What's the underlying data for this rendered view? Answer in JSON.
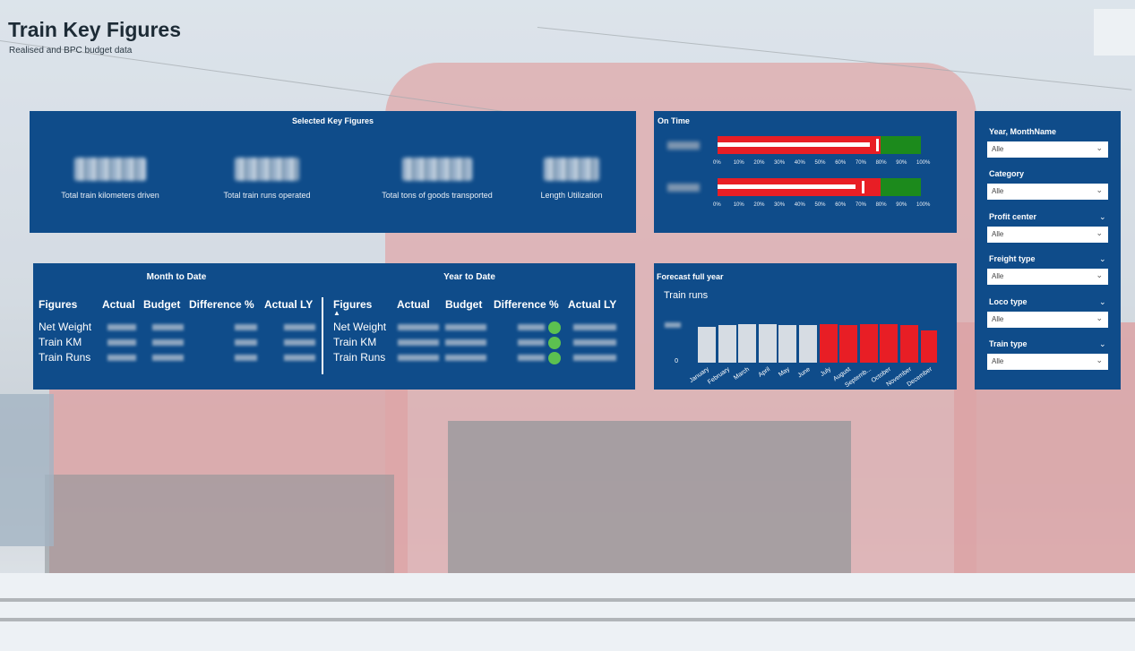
{
  "header": {
    "title": "Train Key Figures",
    "subtitle": "Realised and BPC budget data"
  },
  "selected_key_figures": {
    "title": "Selected Key Figures",
    "kpis": [
      {
        "label": "Total train kilometers driven"
      },
      {
        "label": "Total train runs operated"
      },
      {
        "label": "Total tons of goods transported"
      },
      {
        "label": "Length Utilization"
      }
    ]
  },
  "on_time": {
    "title": "On Time",
    "axis_ticks": [
      "0%",
      "10%",
      "20%",
      "30%",
      "40%",
      "50%",
      "60%",
      "70%",
      "80%",
      "90%",
      "100%"
    ],
    "bullets": [
      {
        "actual_pct": 75,
        "target_pct": 78,
        "good_from_pct": 80
      },
      {
        "actual_pct": 68,
        "target_pct": 71,
        "good_from_pct": 80
      }
    ],
    "colors": {
      "bad": "#e81e25",
      "good": "#1c8a1c",
      "marker": "#ffffff"
    }
  },
  "filters": [
    {
      "label": "Year, MonthName",
      "value": "Alle",
      "has_chevron": false
    },
    {
      "label": "Category",
      "value": "Alle",
      "has_chevron": false
    },
    {
      "label": "Profit center",
      "value": "Alle",
      "has_chevron": true
    },
    {
      "label": "Freight type",
      "value": "Alle",
      "has_chevron": true
    },
    {
      "label": "Loco type",
      "value": "Alle",
      "has_chevron": true
    },
    {
      "label": "Train type",
      "value": "Alle",
      "has_chevron": true
    }
  ],
  "month_to_date": {
    "title": "Month to Date",
    "columns": [
      "Figures",
      "Actual",
      "Budget",
      "Difference %",
      "Actual LY"
    ],
    "rows": [
      "Net Weight",
      "Train KM",
      "Train Runs"
    ]
  },
  "year_to_date": {
    "title": "Year to Date",
    "columns": [
      "Figures",
      "Actual",
      "Budget",
      "Difference %",
      "Actual LY"
    ],
    "rows": [
      "Net Weight",
      "Train KM",
      "Train Runs"
    ],
    "status_color": "#5cc150"
  },
  "forecast": {
    "title": "Forecast full year",
    "subtitle": "Train runs",
    "chart_data": {
      "type": "bar",
      "categories": [
        "January",
        "February",
        "March",
        "April",
        "May",
        "June",
        "July",
        "August",
        "Septemb...",
        "October",
        "November",
        "December"
      ],
      "series": [
        {
          "values": [
            0.92,
            0.95,
            0.98,
            0.97,
            0.95,
            0.96,
            0.97,
            0.96,
            0.98,
            0.97,
            0.96,
            0.82
          ]
        }
      ],
      "bar_kinds": [
        "actual",
        "actual",
        "actual",
        "actual",
        "actual",
        "actual",
        "forecast",
        "forecast",
        "forecast",
        "forecast",
        "forecast",
        "forecast"
      ],
      "colors": {
        "actual": "#d6dce3",
        "forecast": "#e81e25"
      }
    }
  }
}
